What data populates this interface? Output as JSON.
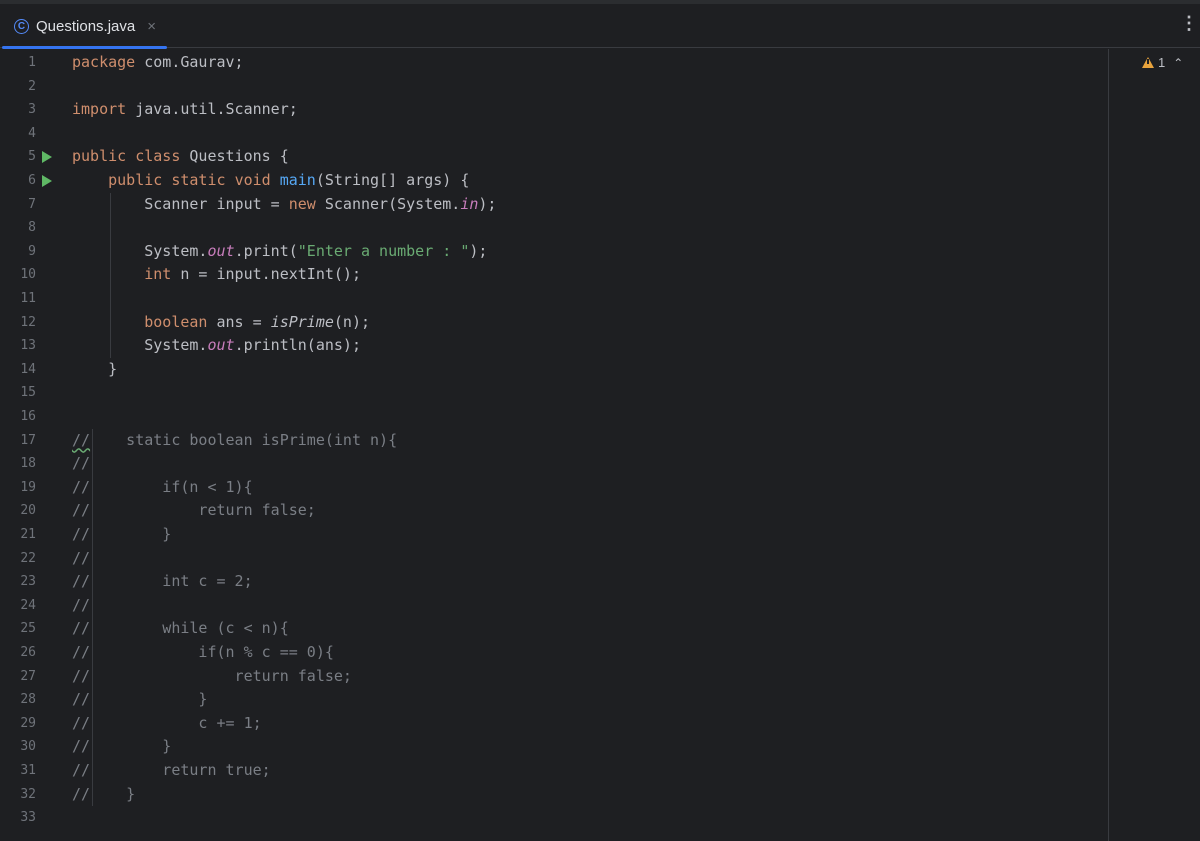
{
  "tab": {
    "title": "Questions.java",
    "icon_letter": "C",
    "close": "×"
  },
  "toolbar": {
    "more": "⋮"
  },
  "inspection": {
    "warning_count": "1",
    "up": "⌃",
    "down": "⌄"
  },
  "colors": {
    "background": "#1e1f22",
    "keyword": "#cf8e6d",
    "string": "#6aab73",
    "method": "#56a8f5",
    "static_field": "#c77dbb",
    "comment": "#7a7e85",
    "accent": "#3574f0",
    "run": "#5fb865",
    "warning": "#e8a33d"
  },
  "lines": [
    {
      "num": "1",
      "text": "package com.Gaurav;"
    },
    {
      "num": "2",
      "text": ""
    },
    {
      "num": "3",
      "text": "import java.util.Scanner;"
    },
    {
      "num": "4",
      "text": ""
    },
    {
      "num": "5",
      "text": "public class Questions {",
      "run": true
    },
    {
      "num": "6",
      "text": "    public static void main(String[] args) {",
      "run": true
    },
    {
      "num": "7",
      "text": "        Scanner input = new Scanner(System.in);"
    },
    {
      "num": "8",
      "text": ""
    },
    {
      "num": "9",
      "text": "        System.out.print(\"Enter a number : \");"
    },
    {
      "num": "10",
      "text": "        int n = input.nextInt();"
    },
    {
      "num": "11",
      "text": ""
    },
    {
      "num": "12",
      "text": "        boolean ans = isPrime(n);"
    },
    {
      "num": "13",
      "text": "        System.out.println(ans);"
    },
    {
      "num": "14",
      "text": "    }"
    },
    {
      "num": "15",
      "text": ""
    },
    {
      "num": "16",
      "text": ""
    },
    {
      "num": "17",
      "text": "//    static boolean isPrime(int n){"
    },
    {
      "num": "18",
      "text": "//"
    },
    {
      "num": "19",
      "text": "//        if(n < 1){"
    },
    {
      "num": "20",
      "text": "//            return false;"
    },
    {
      "num": "21",
      "text": "//        }"
    },
    {
      "num": "22",
      "text": "//"
    },
    {
      "num": "23",
      "text": "//        int c = 2;"
    },
    {
      "num": "24",
      "text": "//"
    },
    {
      "num": "25",
      "text": "//        while (c < n){"
    },
    {
      "num": "26",
      "text": "//            if(n % c == 0){"
    },
    {
      "num": "27",
      "text": "//                return false;"
    },
    {
      "num": "28",
      "text": "//            }"
    },
    {
      "num": "29",
      "text": "//            c += 1;"
    },
    {
      "num": "30",
      "text": "//        }"
    },
    {
      "num": "31",
      "text": "//        return true;"
    },
    {
      "num": "32",
      "text": "//    }"
    },
    {
      "num": "33",
      "text": ""
    }
  ]
}
